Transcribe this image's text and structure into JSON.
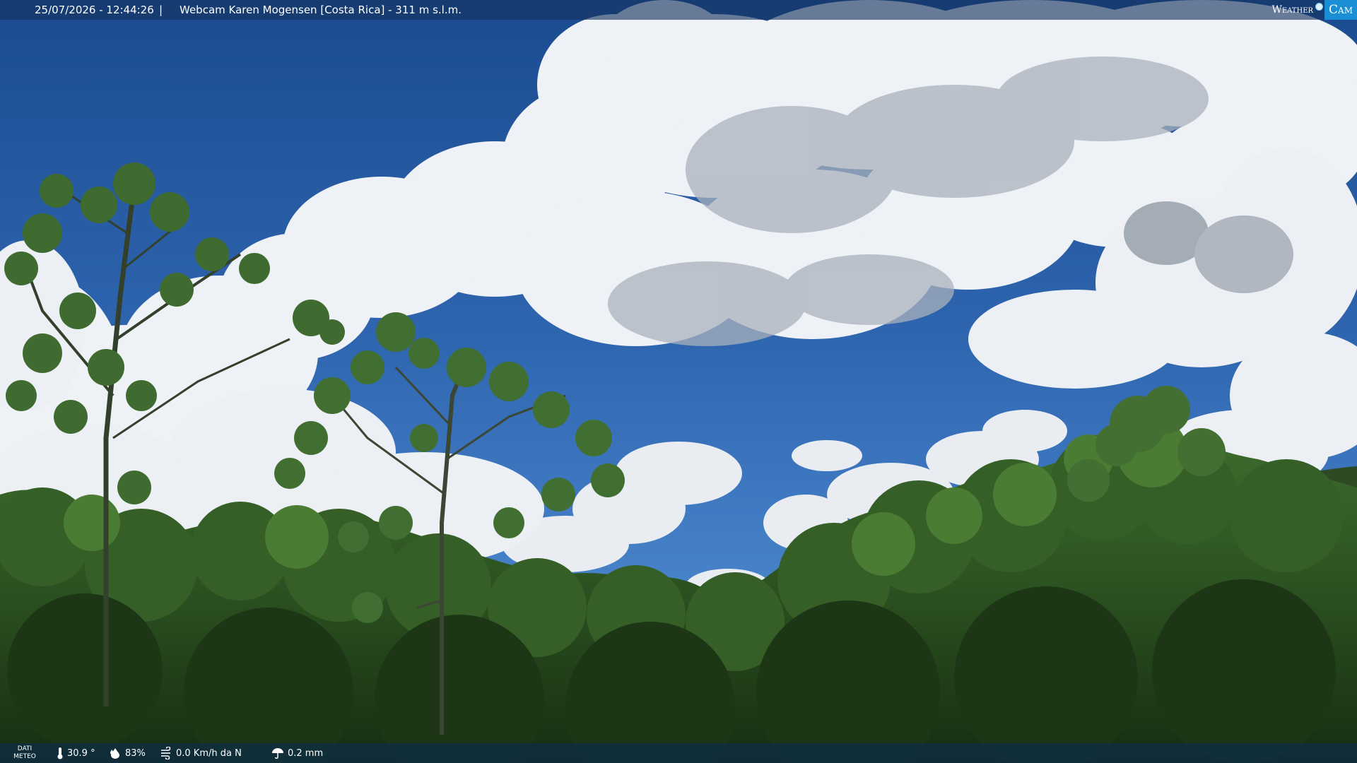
{
  "overlay": {
    "timestamp": "25/07/2026 - 12:44:26",
    "separator": "|",
    "location": "Webcam Karen Mogensen [Costa Rica] - 311 m s.l.m.",
    "logo_left": "Weather",
    "logo_right": "Cam"
  },
  "weather": {
    "label_line1": "DATI",
    "label_line2": "METEO",
    "temperature": "30.9 °",
    "humidity": "83%",
    "wind": "0.0 Km/h da N",
    "rain": "0.2 mm"
  },
  "colors": {
    "sky_top": "#1e4f93",
    "sky_mid": "#3a73bd",
    "foliage_dark": "#1f3d17",
    "foliage_mid": "#3c6a2a",
    "logo_accent": "#1a8fd6"
  },
  "icons": [
    "thermometer-icon",
    "humidity-icon",
    "wind-icon",
    "rain-icon"
  ]
}
